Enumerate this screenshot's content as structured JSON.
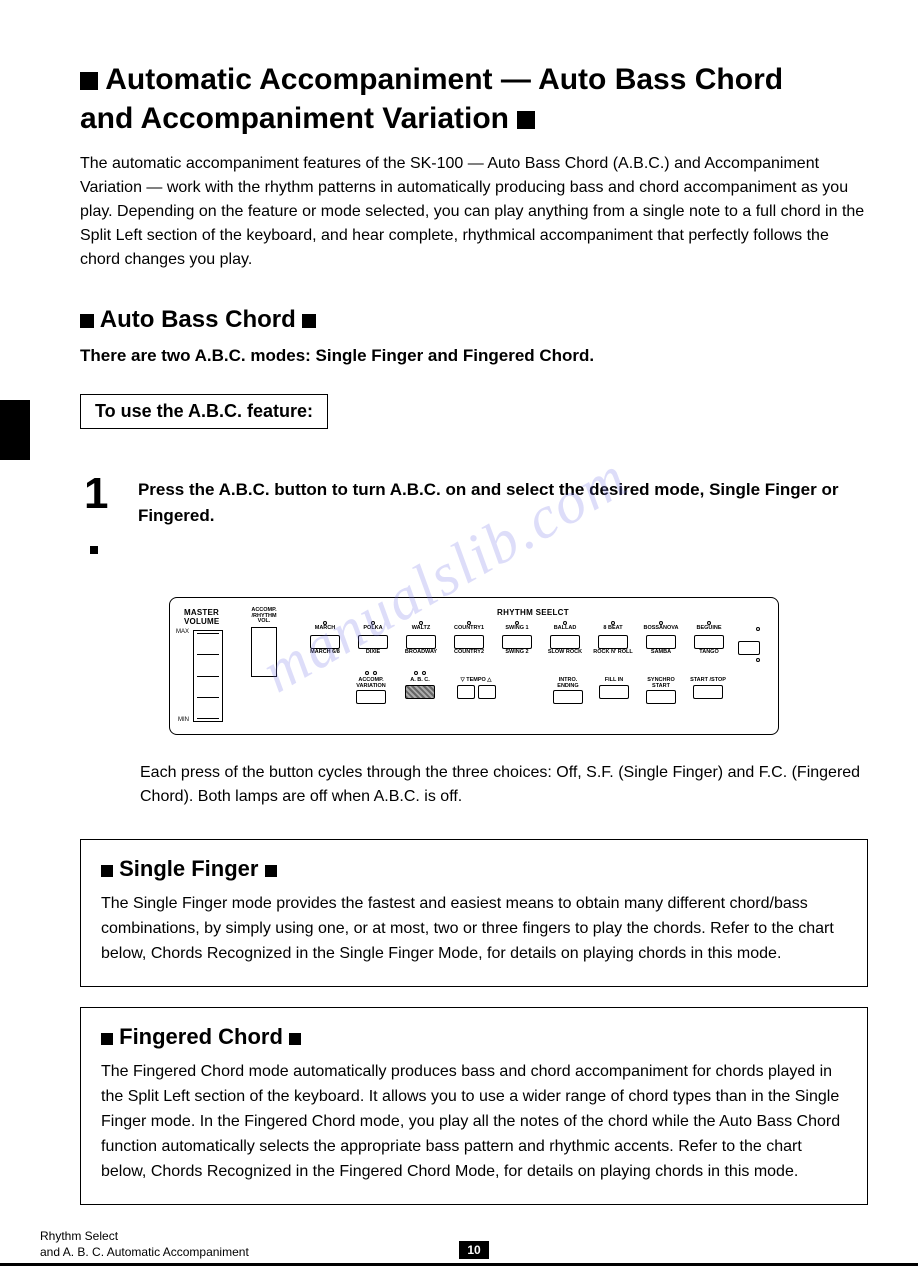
{
  "title_line1_part1": "Automatic Accompaniment — Auto Bass Chord",
  "title_line2": "and Accompaniment Variation",
  "intro": "The automatic accompaniment features of the SK-100 — Auto Bass Chord (A.B.C.) and Accompaniment Variation — work with the rhythm patterns in automatically producing bass and chord accompaniment as you play.  Depending on the feature or mode selected, you can play anything from a single note to a full chord in the Split Left section of the keyboard, and hear complete, rhythmical accompaniment that perfectly follows the chord changes you play.",
  "section_abc": "Auto Bass Chord",
  "modes_line": "There are two A.B.C. modes: Single Finger and Fingered Chord.",
  "use_box": "To use the A.B.C. feature:",
  "step1_num": "1",
  "step1_text": "Press the A.B.C. button to turn A.B.C. on and select the desired mode, Single Finger or Fingered.",
  "panel": {
    "master_volume": "MASTER  VOLUME",
    "max": "MAX",
    "min": "MIN",
    "accomp_vol": "ACCOMP. /RHYTHM VOL.",
    "rhythm_select": "RHYTHM  SEELCT",
    "row1": [
      "MARCH",
      "POLKA",
      "WALTZ",
      "COUNTRY1",
      "SWING 1",
      "BALLAD",
      "8 BEAT",
      "BOSSANOVA",
      "BEGUINE"
    ],
    "row2": [
      "MARCH 6/8",
      "DIXIE",
      "BROADWAY",
      "COUNTRY2",
      "SWING 2",
      "SLOW ROCK",
      "ROCK N' ROLL",
      "SAMBA",
      "TANGO"
    ],
    "bottom": {
      "accomp_variation": "ACCOMP. VARIATION",
      "abc": "A. B. C.",
      "tempo": "▽ TEMPO △",
      "intro_ending": "INTRO. ENDING",
      "fill_in": "FILL IN",
      "synchro_start": "SYNCHRO START",
      "start_stop": "START /STOP"
    }
  },
  "step1_note": "Each press of the button cycles through the three choices: Off, S.F. (Single Finger) and F.C. (Fingered Chord).  Both lamps are off when A.B.C. is off.",
  "sf_title": "Single Finger",
  "sf_body": "The Single Finger mode provides the fastest and easiest means to obtain many different chord/bass combinations, by simply using one, or at most, two or three fingers to play the chords.  Refer to the chart below, Chords Recognized in the Single Finger Mode, for details on playing chords in this mode.",
  "fc_title": "Fingered Chord",
  "fc_body": "The Fingered Chord mode automatically produces bass and chord accompaniment for chords played in the Split Left section of the keyboard.  It allows you to use a wider range of chord types than in the Single Finger mode.  In the Fingered Chord mode, you play all the notes of the chord while the Auto Bass Chord function automatically selects the appropriate bass pattern and rhythmic accents.  Refer to the chart below, Chords Recognized in the Fingered Chord Mode, for details on playing chords in this mode.",
  "footer1": "Rhythm Select",
  "footer2": "and A. B. C. Automatic Accompaniment",
  "page_number": "10",
  "watermark": "manualslib.com"
}
